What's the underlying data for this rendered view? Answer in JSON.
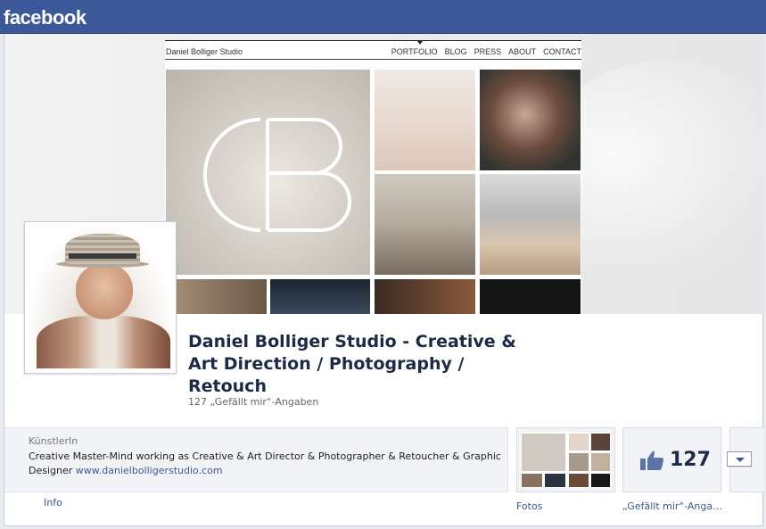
{
  "topbar": {
    "logo": "facebook"
  },
  "cover": {
    "site_brand": "Daniel Bolliger Studio",
    "site_nav": [
      "PORTFOLIO",
      "BLOG",
      "PRESS",
      "ABOUT",
      "CONTACT"
    ]
  },
  "profile": {
    "title": "Daniel Bolliger Studio - Creative & Art Direction / Photography / Retouch",
    "likes_line": "127 „Gefällt mir“-Angaben"
  },
  "about": {
    "category": "KünstlerIn",
    "description": "Creative Master-Mind working as Creative & Art Director & Photographer & Retoucher & Graphic Designer",
    "link": "www.danielbolligerstudio.com",
    "info_label": "Info"
  },
  "apps": {
    "photos_label": "Fotos",
    "like_count": "127",
    "like_label": "„Gefällt mir“-Anga…",
    "more_icon": "chevron-down-icon"
  },
  "colors": {
    "brand": "#3b5998",
    "title": "#1c2a47"
  }
}
